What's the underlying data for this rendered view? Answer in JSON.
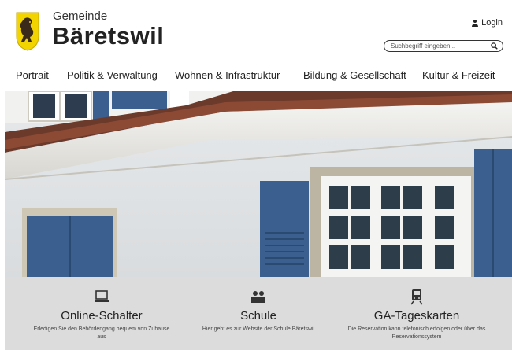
{
  "header": {
    "municipality_prefix": "Gemeinde",
    "municipality_name": "Bäretswil",
    "login_label": "Login",
    "search_placeholder": "Suchbegriff eingeben..."
  },
  "nav": {
    "items": [
      {
        "label": "Portrait"
      },
      {
        "label": "Politik & Verwaltung"
      },
      {
        "label": "Wohnen & Infrastruktur"
      },
      {
        "label": "Bildung & Gesellschaft"
      },
      {
        "label": "Kultur & Freizeit"
      }
    ]
  },
  "tiles": [
    {
      "icon": "laptop-icon",
      "title": "Online-Schalter",
      "description": "Erledigen Sie den Behördengang bequem von Zuhause aus"
    },
    {
      "icon": "people-icon",
      "title": "Schule",
      "description": "Hier geht es zur Website der Schule Bäretswil"
    },
    {
      "icon": "train-icon",
      "title": "GA-Tageskarten",
      "description": "Die Reservation kann telefonisch erfolgen oder über das Reservationssystem"
    }
  ],
  "colors": {
    "tile_background": "#dcdcdc",
    "shutter_blue": "#3b5f8f",
    "logo_yellow": "#f2d400"
  }
}
